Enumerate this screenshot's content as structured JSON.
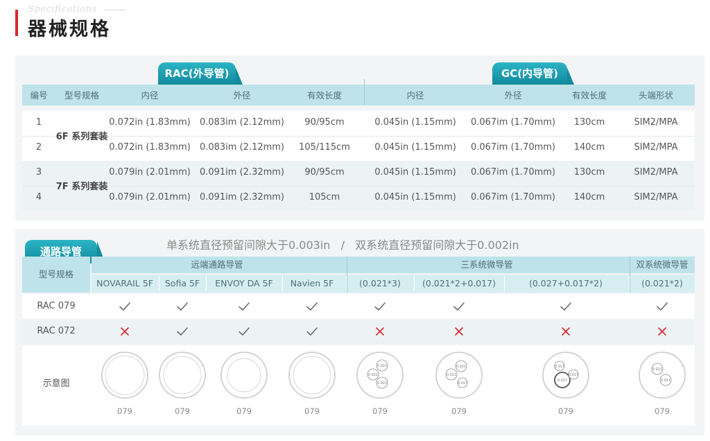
{
  "header": {
    "subtitle": "Specifications",
    "title": "器械规格"
  },
  "table1": {
    "tab_rac": "RAC(外导管)",
    "tab_gc": "GC(内导管)",
    "columns": [
      "编号",
      "型号规格",
      "内径",
      "外径",
      "有效长度",
      "内径",
      "外径",
      "有效长度",
      "头端形状"
    ],
    "groups": [
      "6F 系列套装",
      "7F 系列套装"
    ],
    "rows": [
      [
        "1",
        "0.072in (1.83mm)",
        "0.083im (2.12mm)",
        "90/95cm",
        "0.045in (1.15mm)",
        "0.067im (1.70mm)",
        "130cm",
        "SIM2/MPA"
      ],
      [
        "2",
        "0.072in (1.83mm)",
        "0.083im (2.12mm)",
        "105/115cm",
        "0.045in (1.15mm)",
        "0.067im (1.70mm)",
        "140cm",
        "SIM2/MPA"
      ],
      [
        "3",
        "0.079in (2.01mm)",
        "0.091im (2.32mm)",
        "90/95cm",
        "0.045in (1.15mm)",
        "0.067im (1.70mm)",
        "130cm",
        "SIM2/MPA"
      ],
      [
        "4",
        "0.079in (2.01mm)",
        "0.091im (2.32mm)",
        "105cm",
        "0.045in (1.15mm)",
        "0.067im (1.70mm)",
        "140cm",
        "SIM2/MPA"
      ]
    ]
  },
  "table2": {
    "tab": "通路导管",
    "note": "单系统直径预留间隙大于0.003in   /   双系统直径预留间隙大于0.002in",
    "model_header": "型号规格",
    "group_headers": [
      "远端通路导管",
      "三系统微导管",
      "双系统微导管"
    ],
    "sub_headers": [
      "NOVARAIL 5F",
      "Sofia 5F",
      "ENVOY DA 5F",
      "Navien 5F",
      "(0.021*3)",
      "(0.021*2+0.017)",
      "(0.027+0.017*2)",
      "(0.021*2)"
    ],
    "rows": [
      {
        "label": "RAC 079",
        "marks": [
          "check",
          "check",
          "check",
          "check",
          "check",
          "check",
          "check",
          "check"
        ]
      },
      {
        "label": "RAC 072",
        "marks": [
          "cross",
          "check",
          "check",
          "check",
          "cross",
          "cross",
          "cross",
          "cross"
        ]
      }
    ],
    "diagram_label": "示意图",
    "diagram_captions": [
      "079",
      "079",
      "079",
      "079",
      "079",
      "079",
      "079",
      "079"
    ],
    "micro_labels": {
      "triple_021": [
        "0.021",
        "0.021",
        "0.021"
      ],
      "mixed_021_017": [
        "0.021",
        "0.021",
        "0.017"
      ],
      "mixed_027_017": [
        "0.017",
        "0.027",
        "0.017"
      ],
      "dual_021": [
        "0.021",
        "0.021"
      ]
    }
  },
  "colors": {
    "accent": "#d8262c",
    "teal": "#1a9fb2",
    "header_bg": "#bfe3ea",
    "check": "#6a6a6a",
    "cross": "#d8262c"
  }
}
